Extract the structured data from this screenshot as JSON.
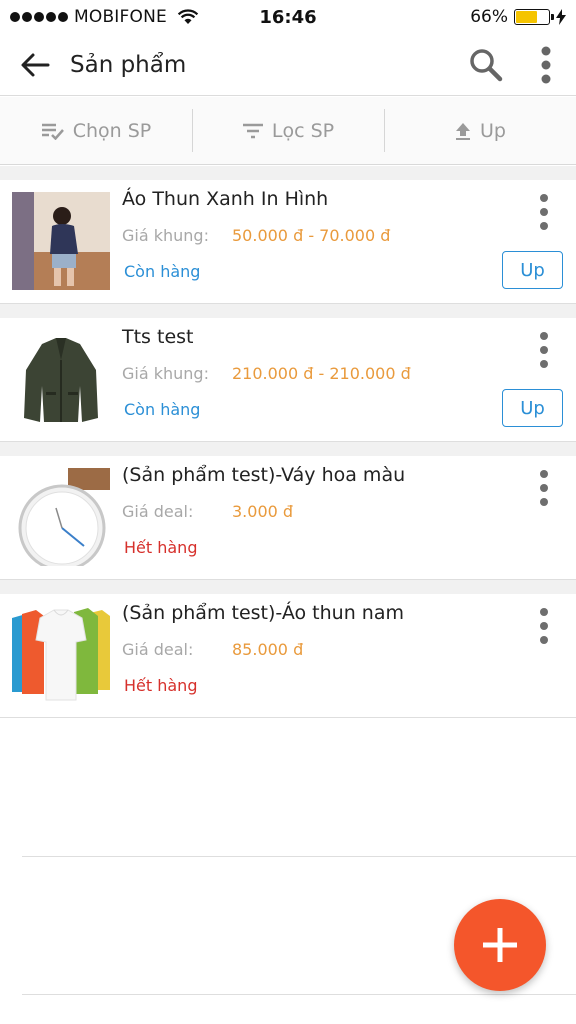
{
  "status_bar": {
    "carrier": "MOBIFONE",
    "time": "16:46",
    "battery_percent": "66%",
    "battery_level": 0.66
  },
  "app_bar": {
    "title": "Sản phẩm"
  },
  "toolbar": {
    "select_label": "Chọn SP",
    "filter_label": "Lọc SP",
    "up_label": "Up"
  },
  "products": [
    {
      "name": "Áo Thun Xanh In Hình",
      "price_label": "Giá khung:",
      "price": "50.000 đ -  70.000 đ",
      "stock": "Còn hàng",
      "up_label": "Up"
    },
    {
      "name": "Tts test",
      "price_label": "Giá khung:",
      "price": "210.000 đ -  210.000 đ",
      "stock": "Còn hàng",
      "up_label": "Up"
    },
    {
      "name": "(Sản phẩm test)-Váy hoa màu",
      "price_label": "Giá deal:",
      "price": "3.000 đ",
      "stock": "Hết hàng"
    },
    {
      "name": "(Sản phẩm test)-Áo thun nam",
      "price_label": "Giá deal:",
      "price": "85.000 đ",
      "stock": "Hết hàng"
    }
  ],
  "colors": {
    "accent_orange": "#e99a3c",
    "in_stock_blue": "#2b8fd6",
    "out_stock_red": "#d6302b",
    "fab": "#f4562b"
  }
}
